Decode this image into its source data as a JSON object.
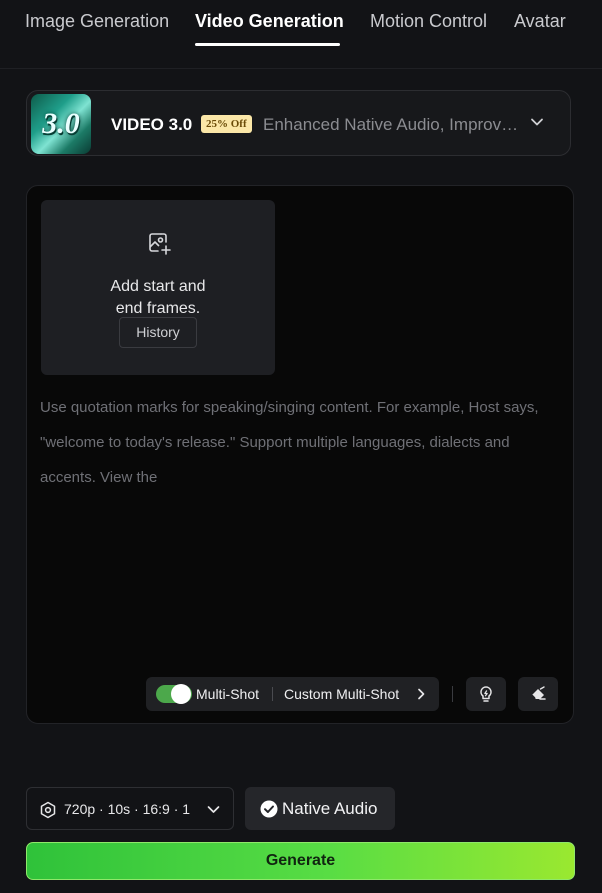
{
  "tabs": [
    {
      "label": "Image Generation",
      "active": false
    },
    {
      "label": "Video Generation",
      "active": true
    },
    {
      "label": "Motion Control",
      "active": false
    },
    {
      "label": "Avatar",
      "active": false
    }
  ],
  "model": {
    "thumb_text": "3.0",
    "name": "VIDEO 3.0",
    "badge": "25% Off",
    "description": "Enhanced Native Audio, Improved Consistency",
    "icon": "chevron-down-icon"
  },
  "frames": {
    "icon": "image-add-icon",
    "label_line1": "Add start and",
    "label_line2": "end frames.",
    "history_label": "History"
  },
  "prompt": {
    "placeholder": "Use quotation marks for speaking/singing content. For example, Host says, \"welcome to today's release.\" Support multiple languages, dialects and accents. View the"
  },
  "multishot": {
    "enabled": true,
    "label": "Multi-Shot",
    "custom_label": "Custom Multi-Shot"
  },
  "toolbar_icons": [
    "lightbulb-icon",
    "eraser-icon"
  ],
  "settings": {
    "icon": "settings-hexagon-icon",
    "summary": "720p · 10s · 16:9 · 1"
  },
  "native_audio": {
    "icon": "check-circle-icon",
    "label": "Native Audio",
    "enabled": true
  },
  "generate": {
    "label": "Generate"
  },
  "colors": {
    "background": "#121316",
    "accent_green": "#4ca84b",
    "generate_start": "#2fc23a",
    "generate_end": "#9ae830",
    "badge_bg": "#fbe7a8"
  }
}
